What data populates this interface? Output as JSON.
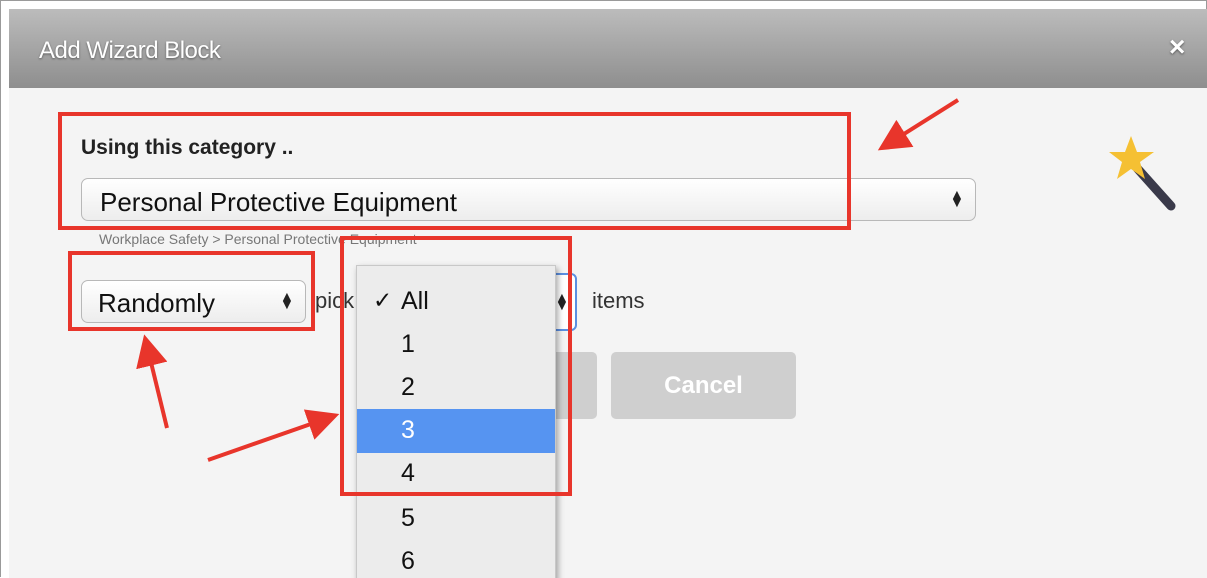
{
  "dialog": {
    "title": "Add Wizard Block",
    "close_label": "×"
  },
  "category": {
    "label": "Using this category ..",
    "selected": "Personal Protective Equipment",
    "breadcrumb": "Workplace Safety > Personal Protective Equipment"
  },
  "mode": {
    "selected": "Randomly",
    "pick_text": "pick",
    "items_text": "items"
  },
  "count_dropdown": {
    "check_mark": "✓",
    "options": [
      "All",
      "1",
      "2",
      "3",
      "4",
      "5",
      "6"
    ],
    "checked_option": "All",
    "highlighted_option": "3"
  },
  "buttons": {
    "cancel": "Cancel"
  },
  "icons": [
    "close-icon",
    "magic-wand-icon",
    "select-updown-icon",
    "checkmark-icon"
  ],
  "colors": {
    "annotation": "#e8352b",
    "option_highlight": "#5694f1",
    "focus_ring": "#5b8fe2"
  }
}
